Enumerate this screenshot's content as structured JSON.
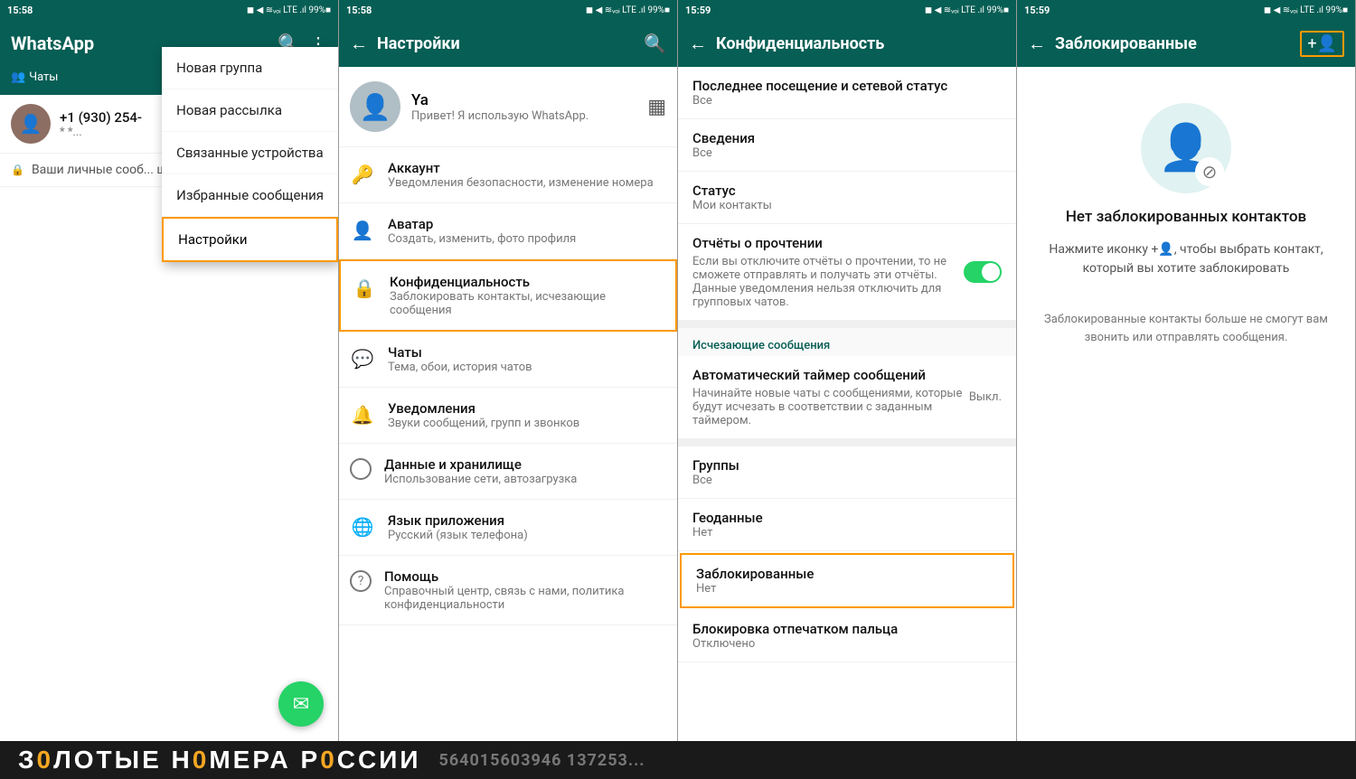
{
  "screens": {
    "screen1": {
      "status_bar": {
        "time": "15:58",
        "icons": "◼ ◀ ≋ LTE ▪▪▪ 99% ■"
      },
      "app_title": "WhatsApp",
      "tab_chats": "Чаты",
      "chat_item": {
        "name": "+1 (930) 254-",
        "preview": "* *...",
        "status_preview": "Ваши личные сооб... ши..."
      },
      "dropdown": {
        "item1": "Новая группа",
        "item2": "Новая рассылка",
        "item3": "Связанные устройства",
        "item4": "Избранные сообщения",
        "item5": "Настройки"
      },
      "fab_icon": "✉"
    },
    "screen2": {
      "status_bar": {
        "time": "15:58",
        "icons": "◼ ◀ ≋ LTE ▪▪▪ 99% ■"
      },
      "bar_title": "Настройки",
      "profile": {
        "name": "Ya",
        "status": "Привет! Я использую WhatsApp."
      },
      "items": [
        {
          "icon": "🔑",
          "title": "Аккаунт",
          "subtitle": "Уведомления безопасности, изменение номера"
        },
        {
          "icon": "👤",
          "title": "Аватар",
          "subtitle": "Создать, изменить, фото профиля"
        },
        {
          "icon": "🔒",
          "title": "Конфиденциальность",
          "subtitle": "Заблокировать контакты, исчезающие сообщения",
          "highlighted": true
        },
        {
          "icon": "💬",
          "title": "Чаты",
          "subtitle": "Тема, обои, история чатов"
        },
        {
          "icon": "🔔",
          "title": "Уведомления",
          "subtitle": "Звуки сообщений, групп и звонков"
        },
        {
          "icon": "◯",
          "title": "Данные и хранилище",
          "subtitle": "Использование сети, автозагрузка"
        },
        {
          "icon": "🌐",
          "title": "Язык приложения",
          "subtitle": "Русский (язык телефона)"
        },
        {
          "icon": "?",
          "title": "Помощь",
          "subtitle": "Справочный центр, связь с нами, политика конфиденциальности"
        }
      ]
    },
    "screen3": {
      "status_bar": {
        "time": "15:59",
        "icons": "◼ ◀ ≋ LTE ▪▪▪ 99% ■"
      },
      "bar_title": "Конфиденциальность",
      "sections": {
        "header_last_seen": "Все",
        "svedeniya_title": "Сведения",
        "svedeniya_value": "Все",
        "status_title": "Статус",
        "status_value": "Мои контакты",
        "otchety_title": "Отчёты о прочтении",
        "otchety_desc": "Если вы отключите отчёты о прочтении, то не сможете отправлять и получать эти отчёты. Данные уведомления нельзя отключить для групповых чатов.",
        "ischezayushie_header": "Исчезающие сообщения",
        "timer_title": "Автоматический таймер сообщений",
        "timer_desc": "Начинайте новые чаты с сообщениями, которые будут исчезать в соответствии с заданным таймером.",
        "timer_value": "Выкл.",
        "gruppy_title": "Группы",
        "gruppy_value": "Все",
        "geodannye_title": "Геоданные",
        "geodannye_value": "Нет",
        "zablok_title": "Заблокированные",
        "zablok_value": "Нет",
        "fingerprint_title": "Блокировка отпечатком пальца",
        "fingerprint_value": "Отключено"
      }
    },
    "screen4": {
      "status_bar": {
        "time": "15:59",
        "icons": "◼ ◀ ≋ LTE ▪▪▪ 99% ■"
      },
      "bar_title": "Заблокированные",
      "add_icon": "+👤",
      "title": "Нет заблокированных контактов",
      "subtitle": "Нажмите иконку +👤, чтобы выбрать контакт, который вы хотите заблокировать",
      "footer": "Заблокированные контакты больше не смогут вам звонить или отправлять сообщения."
    }
  },
  "bottom_bar": {
    "text_part1": "З",
    "text_highlight1": "0",
    "text_part2": "Л",
    "text_highlight2": "0",
    "text_part3": "ТЫЕ НОМ",
    "text_highlight3": "Е",
    "text_part4": "РА Р",
    "text_highlight4": "0",
    "text_part5": "ССИ",
    "text_highlight5": "И",
    "full_text": "З0ЛОТЫЕ Н0МЕРА Р0ССИИ",
    "numbers": "564015603946 137253..."
  }
}
